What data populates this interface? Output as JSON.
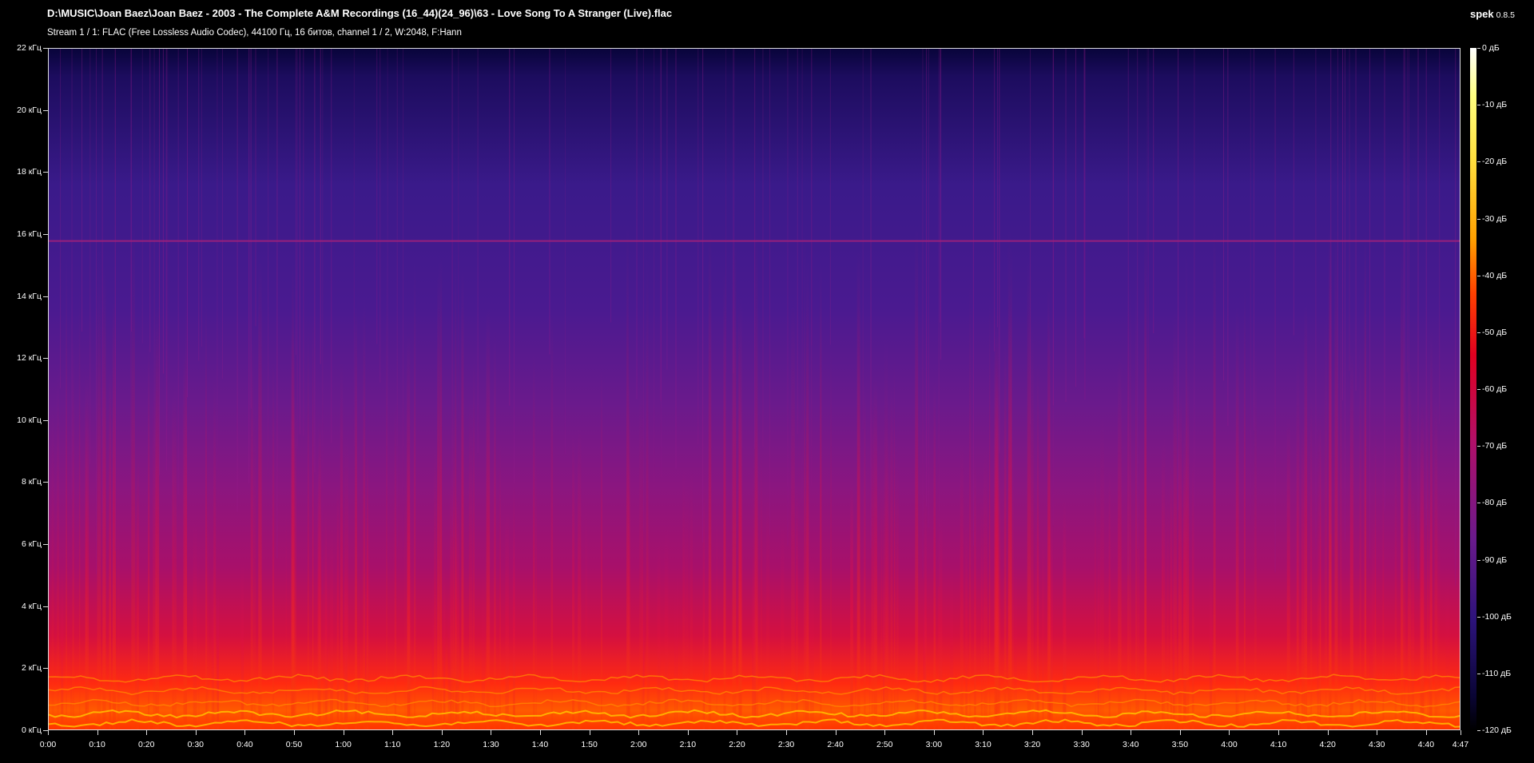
{
  "window": {
    "file_path": "D:\\MUSIC\\Joan Baez\\Joan Baez - 2003 - The Complete A&M Recordings (16_44)(24_96)\\63 - Love Song To A Stranger (Live).flac",
    "stream_info": "Stream 1 / 1: FLAC (Free Lossless Audio Codec), 44100 Гц, 16 битов, channel 1 / 2, W:2048, F:Hann",
    "app_name": "spek",
    "app_version": "0.8.5"
  },
  "spectrogram": {
    "freq_labels": [
      "22 кГц",
      "20 кГц",
      "18 кГц",
      "16 кГц",
      "14 кГц",
      "12 кГц",
      "10 кГц",
      "8 кГц",
      "6 кГц",
      "4 кГц",
      "2 кГц",
      "0 кГц"
    ],
    "freq_values_khz": [
      22,
      20,
      18,
      16,
      14,
      12,
      10,
      8,
      6,
      4,
      2,
      0
    ],
    "freq_range_khz": [
      0,
      22
    ],
    "time_labels": [
      "0:00",
      "0:10",
      "0:20",
      "0:30",
      "0:40",
      "0:50",
      "1:00",
      "1:10",
      "1:20",
      "1:30",
      "1:40",
      "1:50",
      "2:00",
      "2:10",
      "2:20",
      "2:30",
      "2:40",
      "2:50",
      "3:00",
      "3:10",
      "3:20",
      "3:30",
      "3:40",
      "3:50",
      "4:00",
      "4:10",
      "4:20",
      "4:30",
      "4:40",
      "4:47"
    ],
    "time_values_s": [
      0,
      10,
      20,
      30,
      40,
      50,
      60,
      70,
      80,
      90,
      100,
      110,
      120,
      130,
      140,
      150,
      160,
      170,
      180,
      190,
      200,
      210,
      220,
      230,
      240,
      250,
      260,
      270,
      280,
      287
    ],
    "duration_s": 287,
    "lowpass_line_khz": 15.8,
    "db_labels": [
      "0 дБ",
      "-10 дБ",
      "-20 дБ",
      "-30 дБ",
      "-40 дБ",
      "-50 дБ",
      "-60 дБ",
      "-70 дБ",
      "-80 дБ",
      "-90 дБ",
      "-100 дБ",
      "-110 дБ",
      "-120 дБ"
    ],
    "db_values": [
      0,
      -10,
      -20,
      -30,
      -40,
      -50,
      -60,
      -70,
      -80,
      -90,
      -100,
      -110,
      -120
    ]
  },
  "colors": {
    "background": "#000000",
    "axis": "#dddddd",
    "text": "#ffffff",
    "low_freq_energy": "#ff2a00",
    "mid_energy": "#c01070",
    "high_freq_noise": "#3a1a8a",
    "top_band": "#0a0540"
  }
}
